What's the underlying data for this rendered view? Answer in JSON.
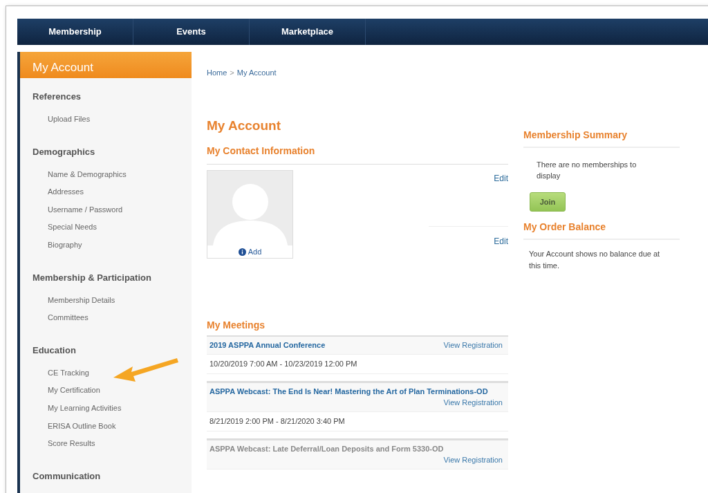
{
  "nav": [
    {
      "label": "Membership"
    },
    {
      "label": "Events"
    },
    {
      "label": "Marketplace"
    }
  ],
  "sidebar": {
    "title": "My Account",
    "groups": [
      {
        "heading": "References",
        "items": [
          "Upload Files"
        ]
      },
      {
        "heading": "Demographics",
        "items": [
          "Name & Demographics",
          "Addresses",
          "Username / Password",
          "Special Needs",
          "Biography"
        ]
      },
      {
        "heading": "Membership & Participation",
        "items": [
          "Membership Details",
          "Committees"
        ]
      },
      {
        "heading": "Education",
        "items": [
          "CE Tracking",
          "My Certification",
          "My Learning Activities",
          "ERISA Outline Book",
          "Score Results"
        ]
      },
      {
        "heading": "Communication"
      }
    ]
  },
  "breadcrumb": [
    "Home",
    "My Account"
  ],
  "breadcrumb_separator": ">",
  "page_title": "My Account",
  "contact": {
    "title": "My Contact Information",
    "photo_action": "Add",
    "edit_links": [
      "Edit",
      "Edit"
    ]
  },
  "meetings": {
    "title": "My Meetings",
    "items": [
      {
        "title": "2019 ASPPA Annual Conference",
        "link": "View Registration",
        "dates": "10/20/2019 7:00 AM - 10/23/2019 12:00 PM",
        "disabled": false,
        "wrap": false
      },
      {
        "title": "ASPPA Webcast: The End Is Near! Mastering the Art of Plan Terminations-OD",
        "link": "View Registration",
        "dates": "8/21/2019 2:00 PM - 8/21/2020 3:40 PM",
        "disabled": false,
        "wrap": true
      },
      {
        "title": "ASPPA Webcast: Late Deferral/Loan Deposits and Form 5330-OD",
        "link": "View Registration",
        "disabled": true,
        "wrap": true
      }
    ]
  },
  "membership_summary": {
    "title": "Membership Summary",
    "text": "There are no memberships to display",
    "button": "Join"
  },
  "order_balance": {
    "title": "My Order Balance",
    "text": "Your Account shows no balance due at this time."
  }
}
